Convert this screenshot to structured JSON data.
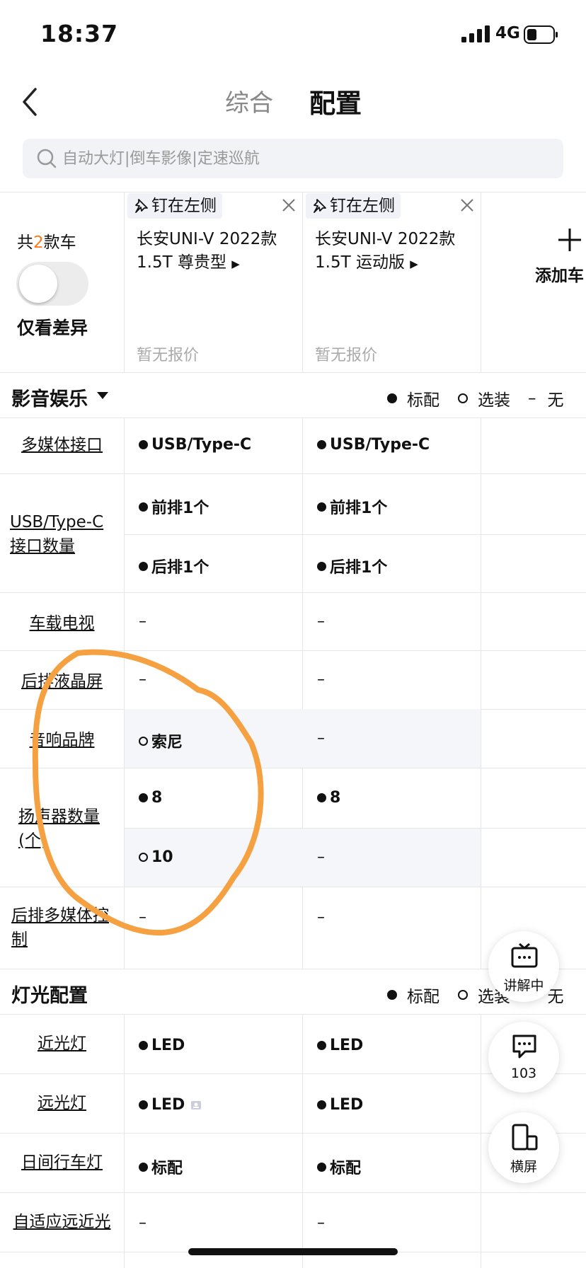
{
  "status_bar": {
    "time": "18:37",
    "network": "4G"
  },
  "nav": {
    "tabs": [
      "综合",
      "配置"
    ],
    "active_tab": "配置"
  },
  "search": {
    "placeholder": "自动大灯|倒车影像|定速巡航"
  },
  "header": {
    "count_prefix": "共",
    "count_num": "2",
    "count_suffix": "款车",
    "diff_toggle_label": "仅看差异",
    "diff_toggle_on": false,
    "add_car_label": "添加车",
    "cars": [
      {
        "pin_label": "钉在左侧",
        "name_line1": "长安UNI-V 2022款",
        "name_line2": "1.5T 尊贵型",
        "price": "暂无报价"
      },
      {
        "pin_label": "钉在左侧",
        "name_line1": "长安UNI-V 2022款",
        "name_line2": "1.5T 运动版",
        "price": "暂无报价"
      }
    ]
  },
  "legend": {
    "standard": "标配",
    "optional": "选装",
    "none_symbol": "–",
    "none": "无"
  },
  "sections": [
    {
      "title": "影音娱乐",
      "rows": [
        {
          "label": "多媒体接口",
          "values": [
            [
              "● USB/Type-C"
            ],
            [
              "● USB/Type-C"
            ]
          ]
        },
        {
          "label_line1": "USB/Type-C",
          "label_line2": "接口数量",
          "values": [
            [
              "● 前排1个",
              "● 后排1个"
            ],
            [
              "● 前排1个",
              "● 后排1个"
            ]
          ]
        },
        {
          "label": "车载电视",
          "values": [
            [
              "–"
            ],
            [
              "–"
            ]
          ]
        },
        {
          "label": "后排液晶屏",
          "values": [
            [
              "–"
            ],
            [
              "–"
            ]
          ]
        },
        {
          "label": "音响品牌",
          "values": [
            [
              "○ 索尼"
            ],
            [
              "–"
            ]
          ]
        },
        {
          "label_line1": "扬声器数量",
          "label_line2": "(个)",
          "values": [
            [
              "● 8",
              "○ 10"
            ],
            [
              "● 8",
              "–"
            ]
          ]
        },
        {
          "label_line1": "后排多媒体控",
          "label_line2": "制",
          "values": [
            [
              "–"
            ],
            [
              "–"
            ]
          ]
        }
      ]
    },
    {
      "title": "灯光配置",
      "rows": [
        {
          "label": "近光灯",
          "values": [
            [
              "● LED"
            ],
            [
              "● LED"
            ]
          ]
        },
        {
          "label": "远光灯",
          "values": [
            [
              "● LED"
            ],
            [
              "● LED"
            ]
          ]
        },
        {
          "label": "日间行车灯",
          "values": [
            [
              "● 标配"
            ],
            [
              "● 标配"
            ]
          ]
        },
        {
          "label": "自适应远近光",
          "values": [
            [
              "–"
            ],
            [
              "–"
            ]
          ]
        }
      ]
    }
  ],
  "cells": {
    "usb": "USB/Type-C",
    "front1": "前排1个",
    "rear1": "后排1个",
    "dash": "–",
    "sony": "索尼",
    "eight": "8",
    "ten": "10",
    "led": "LED",
    "std": "标配"
  },
  "fab": {
    "explain": "讲解中",
    "comments": "103",
    "landscape": "横屏"
  },
  "colors": {
    "accent_orange": "#ff7a1a",
    "annotation_orange": "#f5a142",
    "highlight_bg": "#f5f6fa"
  }
}
